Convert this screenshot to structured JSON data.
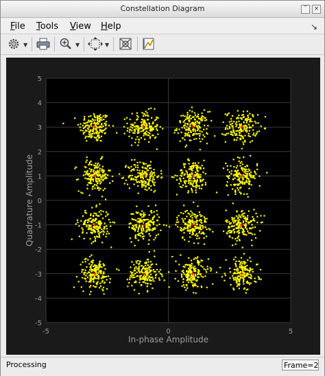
{
  "window": {
    "title": "Constellation Diagram"
  },
  "menubar": {
    "items": [
      {
        "label": "File",
        "underline": "F",
        "rest": "ile"
      },
      {
        "label": "Tools",
        "underline": "T",
        "rest": "ools"
      },
      {
        "label": "View",
        "underline": "V",
        "rest": "iew"
      },
      {
        "label": "Help",
        "underline": "H",
        "rest": "elp"
      }
    ]
  },
  "toolbar": {
    "buttons": [
      "gear-icon",
      "print-icon",
      "zoom-in-icon",
      "scale-axes-icon",
      "data-cursor-icon",
      "measure-icon"
    ]
  },
  "colors": {
    "plot_background": "#000000",
    "pane_background": "#1a1a1a",
    "grid": "#3a3a3a",
    "axis_text": "#9e9e9e",
    "points": "#ffff00",
    "reference": "#ff0000"
  },
  "chart_data": {
    "type": "scatter",
    "title": "",
    "xlabel": "In-phase Amplitude",
    "ylabel": "Quadrature Amplitude",
    "xlim": [
      -5,
      5
    ],
    "ylim": [
      -5,
      5
    ],
    "xticks": [
      -5,
      0,
      5
    ],
    "yticks": [
      -5,
      -4,
      -3,
      -2,
      -1,
      0,
      1,
      2,
      3,
      4,
      5
    ],
    "grid": true,
    "constellation_centers": [
      [
        -3,
        3
      ],
      [
        -1,
        3
      ],
      [
        1,
        3
      ],
      [
        3,
        3
      ],
      [
        -3,
        1
      ],
      [
        -1,
        1
      ],
      [
        1,
        1
      ],
      [
        3,
        1
      ],
      [
        -3,
        -1
      ],
      [
        -1,
        -1
      ],
      [
        1,
        -1
      ],
      [
        3,
        -1
      ],
      [
        -3,
        -3
      ],
      [
        -1,
        -3
      ],
      [
        1,
        -3
      ],
      [
        3,
        -3
      ]
    ],
    "points_per_cluster": 170,
    "approx_spread": 0.32
  },
  "status": {
    "text": "Processing",
    "frame": "Frame=2"
  }
}
